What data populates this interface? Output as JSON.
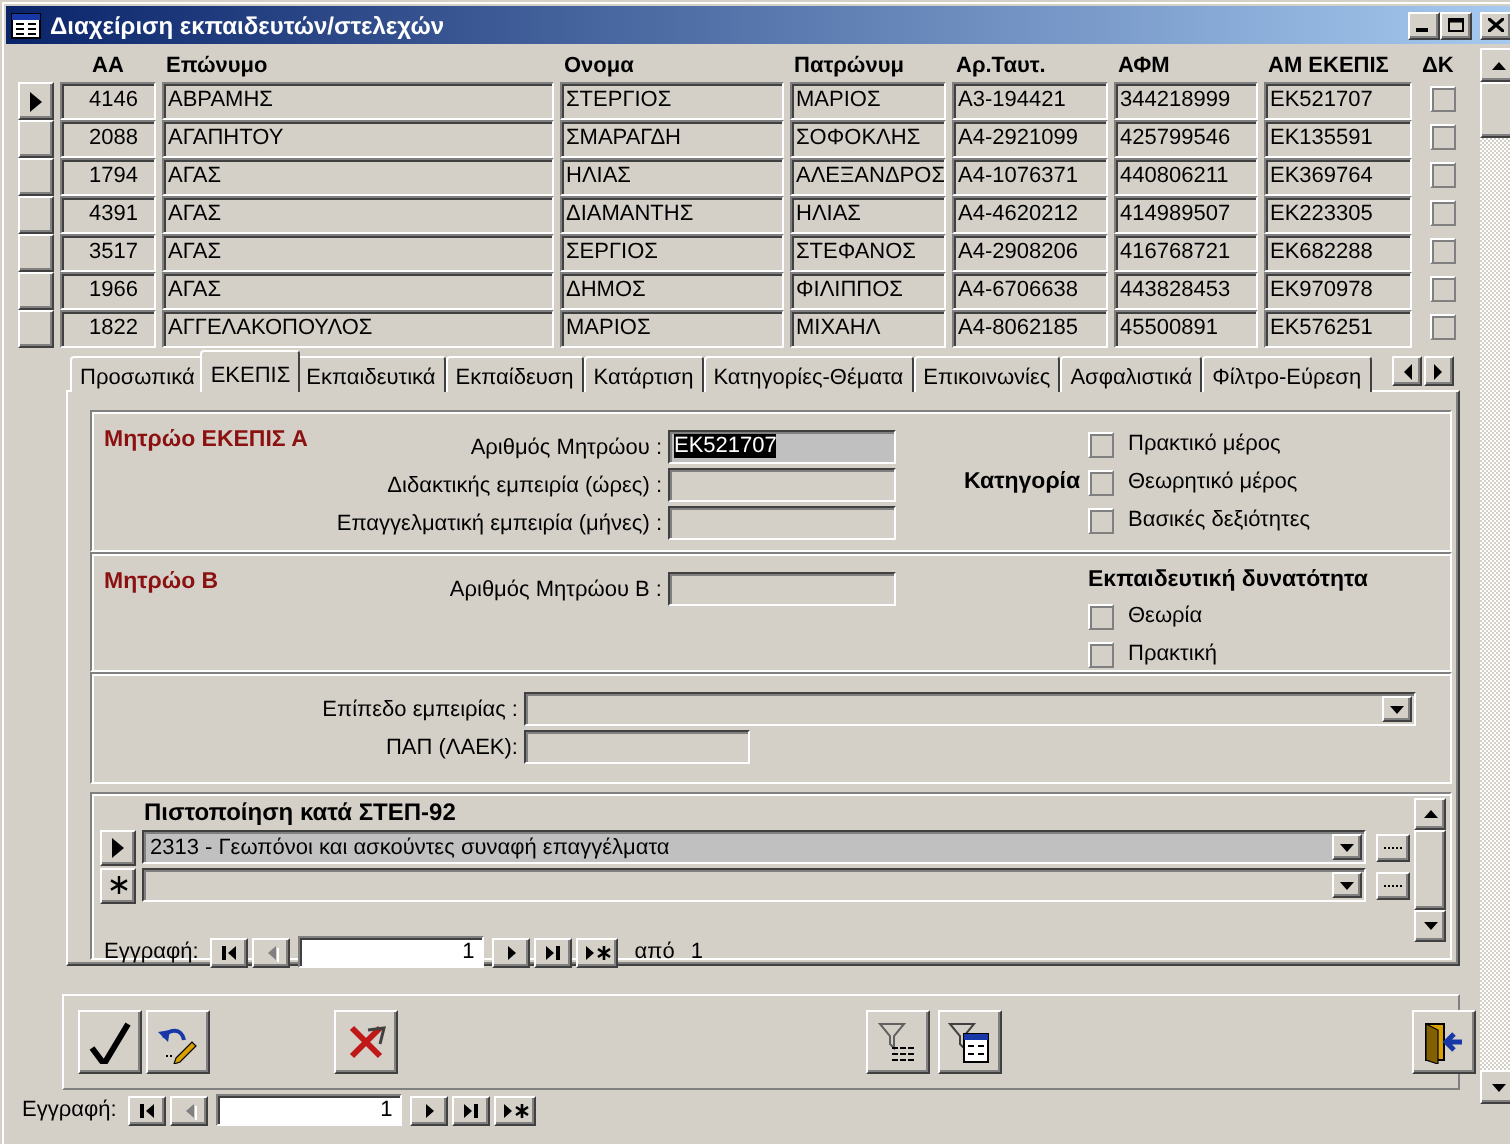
{
  "window": {
    "title": "Διαχείριση εκπαιδευτών/στελεχών"
  },
  "grid": {
    "columns": [
      "ΑΑ",
      "Επώνυμο",
      "Ονομα",
      "Πατρώνυμ",
      "Αρ.Ταυτ.",
      "ΑΦΜ",
      "ΑΜ ΕΚΕΠΙΣ",
      "ΔΚ"
    ],
    "rows": [
      {
        "selected": true,
        "cells": [
          "4146",
          "ΑΒΡΑΜΗΣ",
          "ΣΤΕΡΓΙΟΣ",
          "ΜΑΡΙΟΣ",
          "Α3-194421",
          "344218999",
          "ΕΚ521707"
        ],
        "dk": false
      },
      {
        "selected": false,
        "cells": [
          "2088",
          "ΑΓΑΠΗΤΟΥ",
          "ΣΜΑΡΑΓΔΗ",
          "ΣΟΦΟΚΛΗΣ",
          "Α4-2921099",
          "425799546",
          "ΕΚ135591"
        ],
        "dk": false
      },
      {
        "selected": false,
        "cells": [
          "1794",
          "ΑΓΑΣ",
          "ΗΛΙΑΣ",
          "ΑΛΕΞΑΝΔΡΟΣ",
          "Α4-1076371",
          "440806211",
          "ΕΚ369764"
        ],
        "dk": false
      },
      {
        "selected": false,
        "cells": [
          "4391",
          "ΑΓΑΣ",
          "ΔΙΑΜΑΝΤΗΣ",
          "ΗΛΙΑΣ",
          "Α4-4620212",
          "414989507",
          "ΕΚ223305"
        ],
        "dk": false
      },
      {
        "selected": false,
        "cells": [
          "3517",
          "ΑΓΑΣ",
          "ΣΕΡΓΙΟΣ",
          "ΣΤΕΦΑΝΟΣ",
          "Α4-2908206",
          "416768721",
          "ΕΚ682288"
        ],
        "dk": false
      },
      {
        "selected": false,
        "cells": [
          "1966",
          "ΑΓΑΣ",
          "ΔΗΜΟΣ",
          "ΦΙΛΙΠΠΟΣ",
          "Α4-6706638",
          "443828453",
          "ΕΚ970978"
        ],
        "dk": false
      },
      {
        "selected": false,
        "cells": [
          "1822",
          "ΑΓΓΕΛΑΚΟΠΟΥΛΟΣ",
          "ΜΑΡΙΟΣ",
          "ΜΙΧΑΗΛ",
          "Α4-8062185",
          "45500891",
          "ΕΚ576251"
        ],
        "dk": false
      }
    ]
  },
  "tabs": [
    {
      "label": "Προσωπικά",
      "selected": false
    },
    {
      "label": "ΕΚΕΠΙΣ",
      "selected": true
    },
    {
      "label": "Εκπαιδευτικά",
      "selected": false
    },
    {
      "label": "Εκπαίδευση",
      "selected": false
    },
    {
      "label": "Κατάρτιση",
      "selected": false
    },
    {
      "label": "Κατηγορίες-Θέματα",
      "selected": false
    },
    {
      "label": "Επικοινωνίες",
      "selected": false
    },
    {
      "label": "Ασφαλιστικά",
      "selected": false
    },
    {
      "label": "Φίλτρο-Εύρεση",
      "selected": false
    }
  ],
  "registry_a": {
    "title": "Μητρώο ΕΚΕΠΙΣ Α",
    "fields": [
      {
        "label": "Αριθμός Μητρώου :",
        "value": "ΕΚ521707",
        "highlighted": true
      },
      {
        "label": "Διδακτικής εμπειρία (ώρες) :",
        "highlighted": false
      },
      {
        "label": "Επαγγελματική εμπειρία (μήνες) :",
        "highlighted": false
      }
    ],
    "group_label": "Κατηγορία",
    "options": [
      {
        "label": "Πρακτικό μέρος",
        "checked": false
      },
      {
        "label": "Θεωρητικό μέρος",
        "checked": false
      },
      {
        "label": "Βασικές δεξιότητες",
        "checked": false
      }
    ]
  },
  "registry_b": {
    "title": "Μητρώο Β",
    "fields": [
      {
        "label": "Αριθμός Μητρώου Β :",
        "highlighted": false
      }
    ],
    "group_label": "Εκπαιδευτική δυνατότητα",
    "options": [
      {
        "label": "Θεωρία",
        "checked": false
      },
      {
        "label": "Πρακτική",
        "checked": false
      }
    ]
  },
  "experience": {
    "fields": [
      {
        "kind": "combo",
        "label": "Επίπεδο εμπειρίας :"
      },
      {
        "kind": "text",
        "label": "ΠΑΠ (ΛΑΕΚ):"
      }
    ]
  },
  "certification": {
    "title": "Πιστοποίηση κατά ΣΤΕΠ-92",
    "rows": [
      {
        "kind": "record",
        "selected": true,
        "value": "2313 - Γεωπόνοι και ασκούντες συναφή επαγγέλματα"
      },
      {
        "kind": "new",
        "selected": false
      }
    ],
    "navigator": {
      "label": "Εγγραφή:",
      "current": "1",
      "total_label": "από",
      "total": "1",
      "buttons": [
        {
          "kind": "first",
          "disabled": false
        },
        {
          "kind": "prev",
          "disabled": true
        },
        {
          "kind": "next",
          "disabled": false
        },
        {
          "kind": "last",
          "disabled": false
        },
        {
          "kind": "new",
          "disabled": false
        }
      ]
    }
  },
  "toolbar": {
    "buttons": [
      {
        "kind": "save"
      },
      {
        "kind": "undo"
      },
      {
        "kind": "delete"
      },
      {
        "kind": "filter"
      },
      {
        "kind": "filter_form"
      },
      {
        "kind": "exit"
      }
    ]
  },
  "navigator": {
    "label": "Εγγραφή:",
    "current": "1",
    "buttons": [
      {
        "kind": "first",
        "disabled": false
      },
      {
        "kind": "prev",
        "disabled": true
      },
      {
        "kind": "next",
        "disabled": false
      },
      {
        "kind": "last",
        "disabled": false
      },
      {
        "kind": "new",
        "disabled": false
      }
    ]
  }
}
